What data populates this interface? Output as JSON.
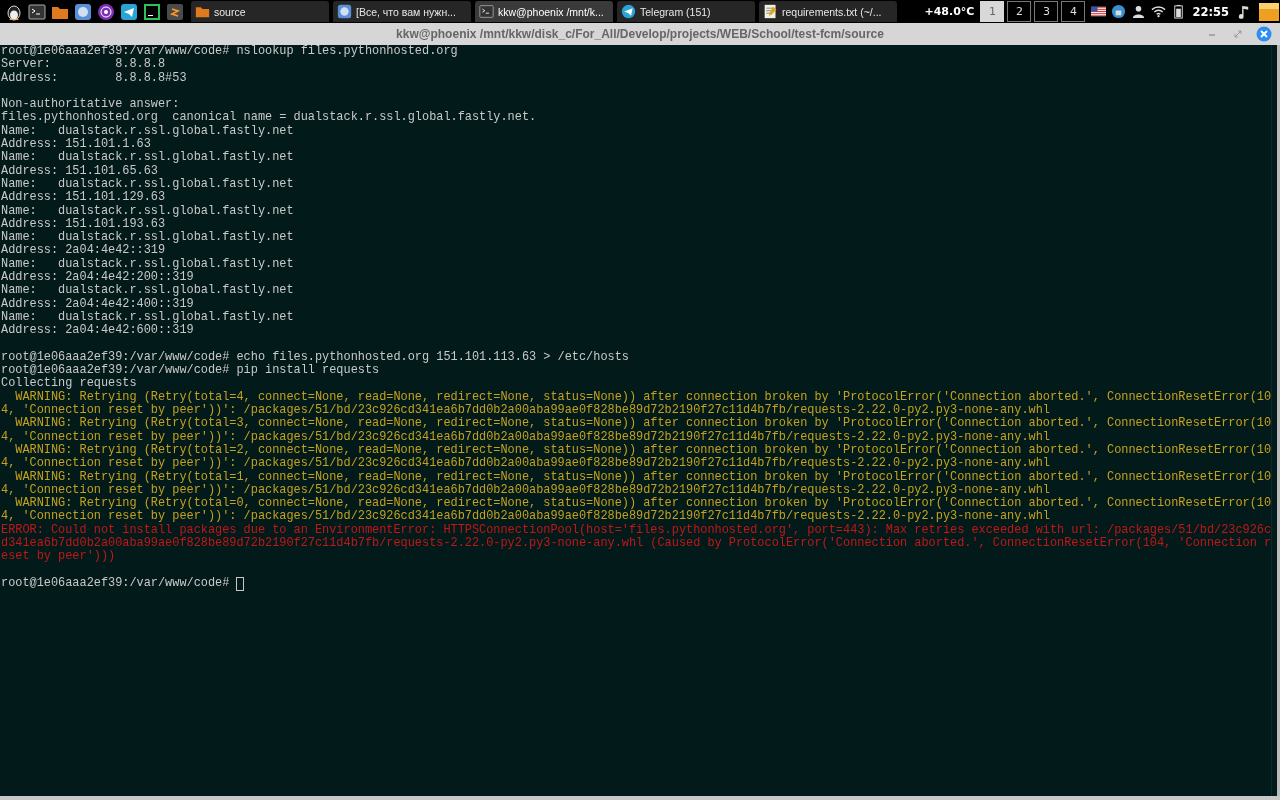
{
  "taskbar": {
    "launchers": [
      {
        "kind": "tux"
      },
      {
        "kind": "terminal"
      },
      {
        "kind": "folder"
      },
      {
        "kind": "browser"
      },
      {
        "kind": "tor"
      },
      {
        "kind": "telegram"
      },
      {
        "kind": "ide"
      },
      {
        "kind": "editor"
      }
    ],
    "tasks": [
      {
        "label": "source",
        "kind": "folder",
        "selected": false
      },
      {
        "label": "[Все, что вам нужн...",
        "kind": "browser",
        "selected": false
      },
      {
        "label": "kkw@phoenix /mnt/k...",
        "kind": "terminal",
        "selected": true
      },
      {
        "label": "Telegram (151)",
        "kind": "telegram",
        "selected": false
      },
      {
        "label": "requirements.txt (~/...",
        "kind": "notepad",
        "selected": false
      }
    ],
    "temperature": "+48.0°C",
    "workspaces": [
      {
        "label": "1",
        "selected": true
      },
      {
        "label": "2",
        "selected": false
      },
      {
        "label": "3",
        "selected": false
      },
      {
        "label": "4",
        "selected": false
      }
    ],
    "tray": [
      {
        "kind": "flag"
      },
      {
        "kind": "network"
      },
      {
        "kind": "user"
      },
      {
        "kind": "wifi"
      },
      {
        "kind": "battery"
      }
    ],
    "clock": "22:55"
  },
  "window": {
    "title": "kkw@phoenix /mnt/kkw/disk_c/For_All/Develop/projects/WEB/School/test-fcm/source"
  },
  "terminal": {
    "lines": [
      {
        "kind": "normal",
        "text": "root@1e06aaa2ef39:/var/www/code# nslookup files.pythonhosted.org"
      },
      {
        "kind": "normal",
        "text": "Server:         8.8.8.8"
      },
      {
        "kind": "normal",
        "text": "Address:        8.8.8.8#53"
      },
      {
        "kind": "blank"
      },
      {
        "kind": "normal",
        "text": "Non-authoritative answer:"
      },
      {
        "kind": "normal",
        "text": "files.pythonhosted.org  canonical name = dualstack.r.ssl.global.fastly.net."
      },
      {
        "kind": "normal",
        "text": "Name:   dualstack.r.ssl.global.fastly.net"
      },
      {
        "kind": "normal",
        "text": "Address: 151.101.1.63"
      },
      {
        "kind": "normal",
        "text": "Name:   dualstack.r.ssl.global.fastly.net"
      },
      {
        "kind": "normal",
        "text": "Address: 151.101.65.63"
      },
      {
        "kind": "normal",
        "text": "Name:   dualstack.r.ssl.global.fastly.net"
      },
      {
        "kind": "normal",
        "text": "Address: 151.101.129.63"
      },
      {
        "kind": "normal",
        "text": "Name:   dualstack.r.ssl.global.fastly.net"
      },
      {
        "kind": "normal",
        "text": "Address: 151.101.193.63"
      },
      {
        "kind": "normal",
        "text": "Name:   dualstack.r.ssl.global.fastly.net"
      },
      {
        "kind": "normal",
        "text": "Address: 2a04:4e42::319"
      },
      {
        "kind": "normal",
        "text": "Name:   dualstack.r.ssl.global.fastly.net"
      },
      {
        "kind": "normal",
        "text": "Address: 2a04:4e42:200::319"
      },
      {
        "kind": "normal",
        "text": "Name:   dualstack.r.ssl.global.fastly.net"
      },
      {
        "kind": "normal",
        "text": "Address: 2a04:4e42:400::319"
      },
      {
        "kind": "normal",
        "text": "Name:   dualstack.r.ssl.global.fastly.net"
      },
      {
        "kind": "normal",
        "text": "Address: 2a04:4e42:600::319"
      },
      {
        "kind": "blank"
      },
      {
        "kind": "normal",
        "text": "root@1e06aaa2ef39:/var/www/code# echo files.pythonhosted.org 151.101.113.63 > /etc/hosts"
      },
      {
        "kind": "normal",
        "text": "root@1e06aaa2ef39:/var/www/code# pip install requests"
      },
      {
        "kind": "normal",
        "text": "Collecting requests"
      },
      {
        "kind": "warning",
        "text": "  WARNING: Retrying (Retry(total=4, connect=None, read=None, redirect=None, status=None)) after connection broken by 'ProtocolError('Connection aborted.', ConnectionResetError(10"
      },
      {
        "kind": "warning",
        "text": "4, 'Connection reset by peer'))': /packages/51/bd/23c926cd341ea6b7dd0b2a00aba99ae0f828be89d72b2190f27c11d4b7fb/requests-2.22.0-py2.py3-none-any.whl"
      },
      {
        "kind": "warning",
        "text": "  WARNING: Retrying (Retry(total=3, connect=None, read=None, redirect=None, status=None)) after connection broken by 'ProtocolError('Connection aborted.', ConnectionResetError(10"
      },
      {
        "kind": "warning",
        "text": "4, 'Connection reset by peer'))': /packages/51/bd/23c926cd341ea6b7dd0b2a00aba99ae0f828be89d72b2190f27c11d4b7fb/requests-2.22.0-py2.py3-none-any.whl"
      },
      {
        "kind": "warning",
        "text": "  WARNING: Retrying (Retry(total=2, connect=None, read=None, redirect=None, status=None)) after connection broken by 'ProtocolError('Connection aborted.', ConnectionResetError(10"
      },
      {
        "kind": "warning",
        "text": "4, 'Connection reset by peer'))': /packages/51/bd/23c926cd341ea6b7dd0b2a00aba99ae0f828be89d72b2190f27c11d4b7fb/requests-2.22.0-py2.py3-none-any.whl"
      },
      {
        "kind": "warning",
        "text": "  WARNING: Retrying (Retry(total=1, connect=None, read=None, redirect=None, status=None)) after connection broken by 'ProtocolError('Connection aborted.', ConnectionResetError(10"
      },
      {
        "kind": "warning",
        "text": "4, 'Connection reset by peer'))': /packages/51/bd/23c926cd341ea6b7dd0b2a00aba99ae0f828be89d72b2190f27c11d4b7fb/requests-2.22.0-py2.py3-none-any.whl"
      },
      {
        "kind": "warning",
        "text": "  WARNING: Retrying (Retry(total=0, connect=None, read=None, redirect=None, status=None)) after connection broken by 'ProtocolError('Connection aborted.', ConnectionResetError(10"
      },
      {
        "kind": "warning",
        "text": "4, 'Connection reset by peer'))': /packages/51/bd/23c926cd341ea6b7dd0b2a00aba99ae0f828be89d72b2190f27c11d4b7fb/requests-2.22.0-py2.py3-none-any.whl"
      },
      {
        "kind": "error",
        "text": "ERROR: Could not install packages due to an EnvironmentError: HTTPSConnectionPool(host='files.pythonhosted.org', port=443): Max retries exceeded with url: /packages/51/bd/23c926c"
      },
      {
        "kind": "error",
        "text": "d341ea6b7dd0b2a00aba99ae0f828be89d72b2190f27c11d4b7fb/requests-2.22.0-py2.py3-none-any.whl (Caused by ProtocolError('Connection aborted.', ConnectionResetError(104, 'Connection r"
      },
      {
        "kind": "error",
        "text": "eset by peer')))"
      },
      {
        "kind": "blank"
      },
      {
        "kind": "prompt",
        "text": "root@1e06aaa2ef39:/var/www/code#"
      }
    ]
  }
}
